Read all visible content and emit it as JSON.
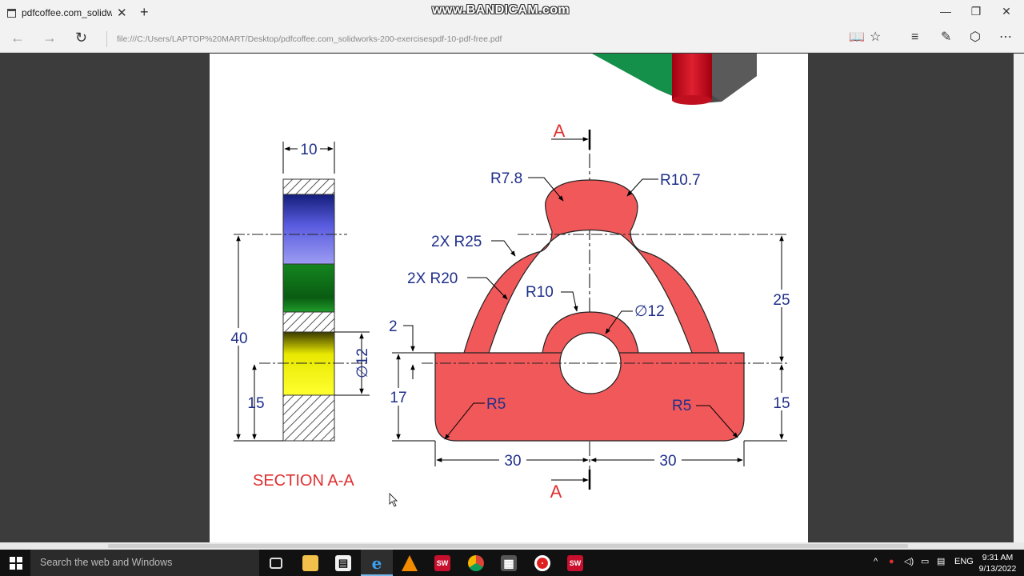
{
  "browser": {
    "tab_title": "pdfcoffee.com_solidwork",
    "tab_close": "✕",
    "new_tab": "+",
    "watermark": "www.BANDICAM.com",
    "window_controls": {
      "minimize": "—",
      "restore": "❐",
      "close": "✕"
    },
    "nav": {
      "back": "←",
      "forward": "→",
      "refresh": "↻"
    },
    "address": "file:///C:/Users/LAPTOP%20MART/Desktop/pdfcoffee.com_solidworks-200-exercisespdf-10-pdf-free.pdf",
    "toolbar_icons": {
      "reading_view": "📖",
      "favorite": "☆",
      "hub": "≡",
      "web_note": "✎",
      "share": "⬡",
      "more": "⋯"
    }
  },
  "drawing": {
    "section_label": "SECTION A-A",
    "section_marker_top": "A",
    "section_marker_bottom": "A",
    "section_view": {
      "width_dim": "10",
      "height_dim": "40",
      "center_height_dim": "15",
      "hole_dia_dim": "∅12",
      "band_colors": [
        "#5a5ce0",
        "#14851f",
        "#e8e800"
      ]
    },
    "front_view": {
      "r_top_small": "R7.8",
      "r_top_outer": "R10.7",
      "r25": "2X R25",
      "r20": "2X R20",
      "r10": "R10",
      "hole_dia": "∅12",
      "dim_2": "2",
      "dim_17": "17",
      "r5_left": "R5",
      "r5_right": "R5",
      "dim_25": "25",
      "dim_15": "15",
      "half_width_left": "30",
      "half_width_right": "30"
    },
    "colors": {
      "part_fill": "#f0585a",
      "dimension_text": "#1f2f8a",
      "section_text": "#e03030"
    }
  },
  "taskbar": {
    "search_placeholder": "Search the web and Windows",
    "apps": [
      "task-view",
      "file-explorer",
      "store",
      "edge",
      "vlc",
      "solidworks",
      "chrome",
      "calculator",
      "bandicam",
      "solidworks-2018"
    ],
    "solidworks_label": "SW",
    "language": "ENG",
    "time": "9:31 AM",
    "date": "9/13/2022"
  }
}
